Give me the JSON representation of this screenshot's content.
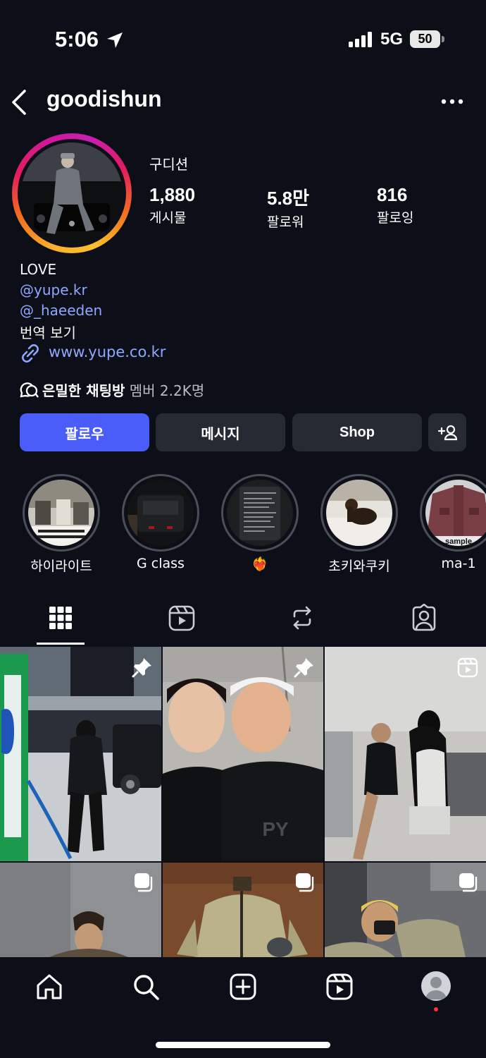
{
  "status_bar": {
    "time": "5:06",
    "network": "5G",
    "battery": "50"
  },
  "header": {
    "username": "goodishun"
  },
  "profile": {
    "name": "구디션",
    "stats": [
      {
        "value": "1,880",
        "label": "게시물"
      },
      {
        "value": "5.8만",
        "label": "팔로워"
      },
      {
        "value": "816",
        "label": "팔로잉"
      }
    ],
    "bio": {
      "line1": "LOVE",
      "mention1": "@yupe.kr",
      "mention2": "@_haeeden",
      "translate": "번역 보기",
      "url": "www.yupe.co.kr"
    },
    "chat": {
      "title": "은밀한 채팅방",
      "members": "멤버 2.2K명"
    }
  },
  "buttons": {
    "follow": "팔로우",
    "message": "메시지",
    "shop": "Shop"
  },
  "highlights": [
    {
      "label": "하이라이트"
    },
    {
      "label": "G class"
    },
    {
      "label": "❤️‍🔥"
    },
    {
      "label": "초키와쿠키"
    },
    {
      "label": "ma-1"
    }
  ],
  "highlight_sample_text": "sample",
  "colors": {
    "background": "#0c0f17",
    "follow_button": "#4a5df9",
    "secondary_button": "#262a33",
    "link": "#8fa8ff",
    "notification_dot": "#ff3040"
  },
  "icons": {
    "tabs": [
      "grid-icon",
      "reels-icon",
      "reposts-icon",
      "tagged-icon"
    ],
    "nav": [
      "home-icon",
      "search-icon",
      "create-icon",
      "reels-icon",
      "profile-avatar"
    ]
  }
}
